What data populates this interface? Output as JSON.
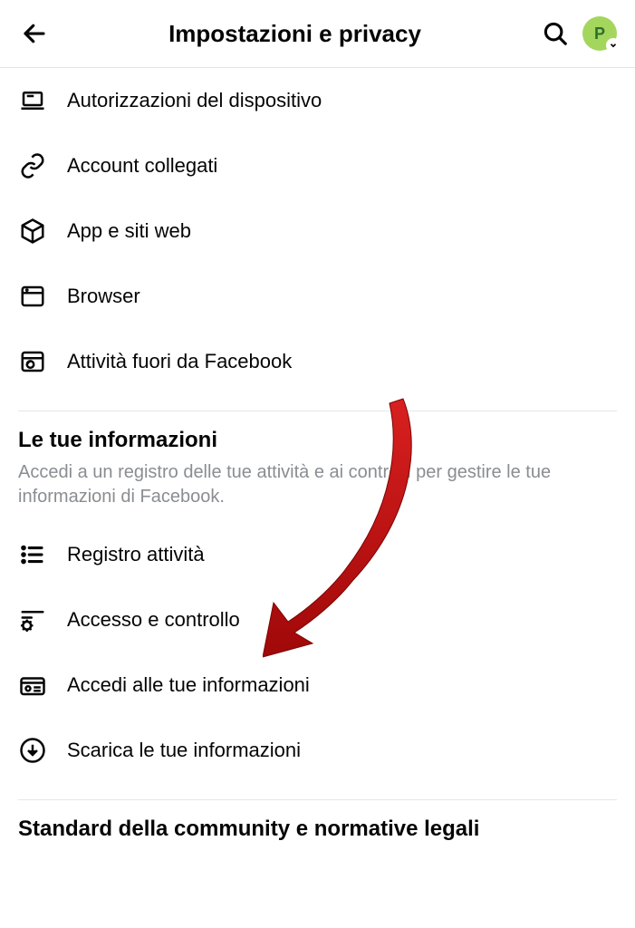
{
  "header": {
    "title": "Impostazioni e privacy",
    "avatar_initial": "P"
  },
  "section1": {
    "items": [
      {
        "label": "Autorizzazioni del dispositivo"
      },
      {
        "label": "Account collegati"
      },
      {
        "label": "App e siti web"
      },
      {
        "label": "Browser"
      },
      {
        "label": "Attività fuori da Facebook"
      }
    ]
  },
  "section2": {
    "title": "Le tue informazioni",
    "description": "Accedi a un registro delle tue attività e ai controlli per gestire le tue informazioni di Facebook.",
    "items": [
      {
        "label": "Registro attività"
      },
      {
        "label": "Accesso e controllo"
      },
      {
        "label": "Accedi alle tue informazioni"
      },
      {
        "label": "Scarica le tue informazioni"
      }
    ]
  },
  "section3": {
    "title": "Standard della community e normative legali"
  }
}
